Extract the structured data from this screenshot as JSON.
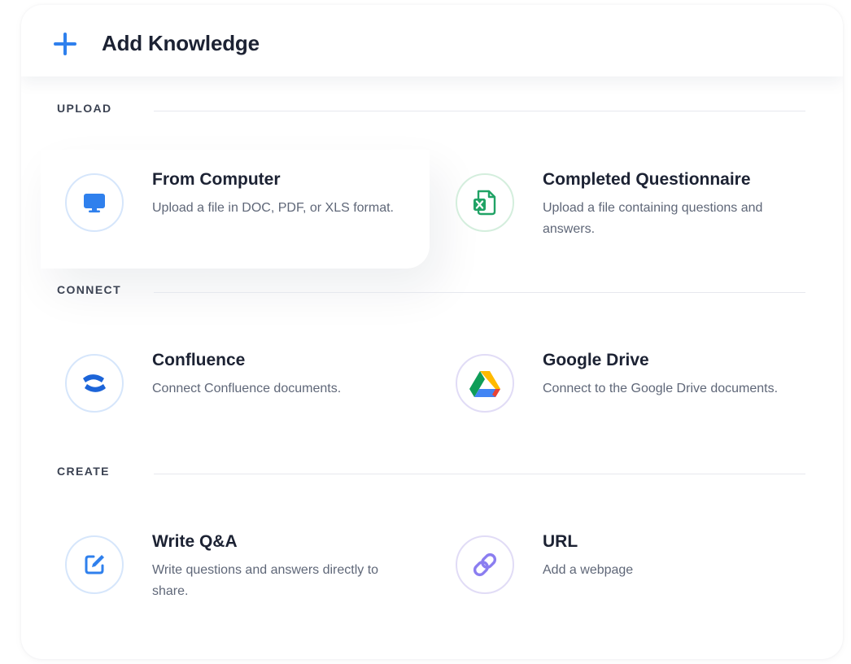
{
  "header": {
    "title": "Add Knowledge",
    "icon": "plus-icon"
  },
  "colors": {
    "accent": "#2f80ed",
    "excel_green": "#21a366",
    "confluence_blue": "#1c64d8",
    "link_purple": "#8b7ef0",
    "title_text": "#1c2233",
    "muted_text": "#5f6778"
  },
  "sections": {
    "upload": {
      "label": "UPLOAD",
      "items": [
        {
          "title": "From Computer",
          "description": "Upload a file in DOC, PDF, or XLS format.",
          "icon": "computer-monitor-icon"
        },
        {
          "title": "Completed Questionnaire",
          "description": "Upload a file containing questions and answers.",
          "icon": "excel-file-icon"
        }
      ]
    },
    "connect": {
      "label": "CONNECT",
      "items": [
        {
          "title": "Confluence",
          "description": "Connect Confluence documents.",
          "icon": "confluence-icon"
        },
        {
          "title": "Google Drive",
          "description": "Connect to the Google Drive documents.",
          "icon": "google-drive-icon"
        }
      ]
    },
    "create": {
      "label": "CREATE",
      "items": [
        {
          "title": "Write Q&A",
          "description": "Write questions and answers directly to share.",
          "icon": "edit-pencil-icon"
        },
        {
          "title": "URL",
          "description": "Add a webpage",
          "icon": "link-icon"
        }
      ]
    }
  }
}
